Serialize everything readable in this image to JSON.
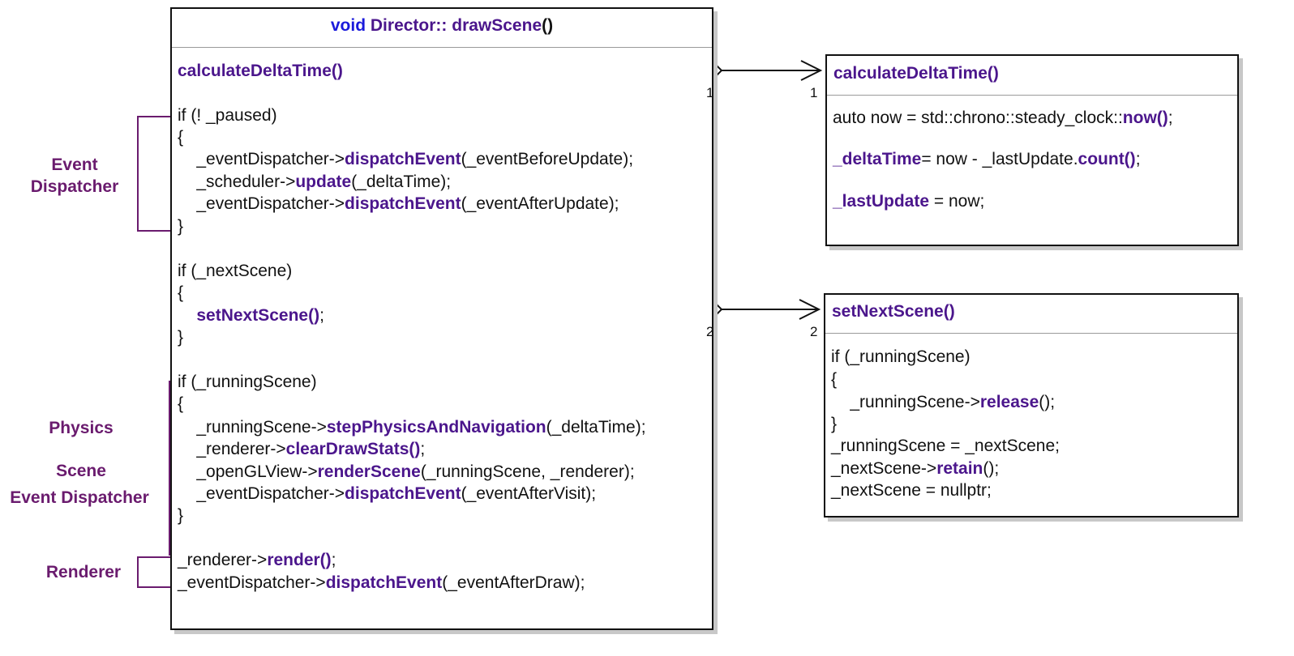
{
  "main": {
    "title_kw": "void",
    "title_name": "Director:: drawScene",
    "title_parens": "()",
    "lines": [
      [
        {
          "t": "calculateDeltaTime()",
          "h": true
        }
      ],
      [
        {
          "t": "if (! _paused)"
        }
      ],
      [
        {
          "t": "{"
        }
      ],
      [
        {
          "t": "    _eventDispatcher->"
        },
        {
          "t": "dispatchEvent",
          "h": true
        },
        {
          "t": "(_eventBeforeUpdate);"
        }
      ],
      [
        {
          "t": "    _scheduler->"
        },
        {
          "t": "update",
          "h": true
        },
        {
          "t": "(_deltaTime);"
        }
      ],
      [
        {
          "t": "    _eventDispatcher->"
        },
        {
          "t": "dispatchEvent",
          "h": true
        },
        {
          "t": "(_eventAfterUpdate);"
        }
      ],
      [
        {
          "t": "}"
        }
      ],
      [
        {
          "t": "if (_nextScene)"
        }
      ],
      [
        {
          "t": "{"
        }
      ],
      [
        {
          "t": "    "
        },
        {
          "t": "setNextScene()",
          "h": true
        },
        {
          "t": ";"
        }
      ],
      [
        {
          "t": "}"
        }
      ],
      [
        {
          "t": "if (_runningScene)"
        }
      ],
      [
        {
          "t": "{"
        }
      ],
      [
        {
          "t": "    _runningScene->"
        },
        {
          "t": "stepPhysicsAndNavigation",
          "h": true
        },
        {
          "t": "(_deltaTime);"
        }
      ],
      [
        {
          "t": "    _renderer->"
        },
        {
          "t": "clearDrawStats()",
          "h": true
        },
        {
          "t": ";"
        }
      ],
      [
        {
          "t": "    _openGLView->"
        },
        {
          "t": "renderScene",
          "h": true
        },
        {
          "t": "(_runningScene, _renderer);"
        }
      ],
      [
        {
          "t": "    _eventDispatcher->"
        },
        {
          "t": "dispatchEvent",
          "h": true
        },
        {
          "t": "(_eventAfterVisit);"
        }
      ],
      [
        {
          "t": "}"
        }
      ],
      [
        {
          "t": "_renderer->"
        },
        {
          "t": "render()",
          "h": true
        },
        {
          "t": ";"
        }
      ],
      [
        {
          "t": "_eventDispatcher->"
        },
        {
          "t": "dispatchEvent",
          "h": true
        },
        {
          "t": "(_eventAfterDraw);"
        }
      ]
    ]
  },
  "calc": {
    "title": "calculateDeltaTime()",
    "lines": [
      [
        {
          "t": "auto now = std::chrono::steady_clock::"
        },
        {
          "t": "now()",
          "h": true
        },
        {
          "t": ";"
        }
      ],
      [
        {
          "t": "_deltaTime",
          "h": true
        },
        {
          "t": "= now - _lastUpdate."
        },
        {
          "t": "count()",
          "h": true
        },
        {
          "t": ";"
        }
      ],
      [
        {
          "t": "_lastUpdate",
          "h": true
        },
        {
          "t": " = now;"
        }
      ]
    ]
  },
  "next": {
    "title": "setNextScene()",
    "lines": [
      [
        {
          "t": "if (_runningScene)"
        }
      ],
      [
        {
          "t": "{"
        }
      ],
      [
        {
          "t": "    _runningScene->"
        },
        {
          "t": "release",
          "h": true
        },
        {
          "t": "();"
        }
      ],
      [
        {
          "t": "}"
        }
      ],
      [
        {
          "t": "_runningScene = _nextScene;"
        }
      ],
      [
        {
          "t": "_nextScene->"
        },
        {
          "t": "retain",
          "h": true
        },
        {
          "t": "();"
        }
      ],
      [
        {
          "t": "_nextScene = nullptr;"
        }
      ]
    ]
  },
  "labels": {
    "event_dispatcher_top": "Event\nDispatcher",
    "physics": "Physics",
    "scene": "Scene",
    "event_dispatcher_bottom": "Event Dispatcher",
    "renderer": "Renderer"
  },
  "multiplicities": {
    "calc_source": "1",
    "calc_target": "1",
    "next_source": "2",
    "next_target": "2"
  },
  "colors": {
    "highlight": "#4b168c",
    "keyword": "#1a1adb",
    "side_label": "#6a1b6e",
    "bracket": "#6a1b6e"
  }
}
